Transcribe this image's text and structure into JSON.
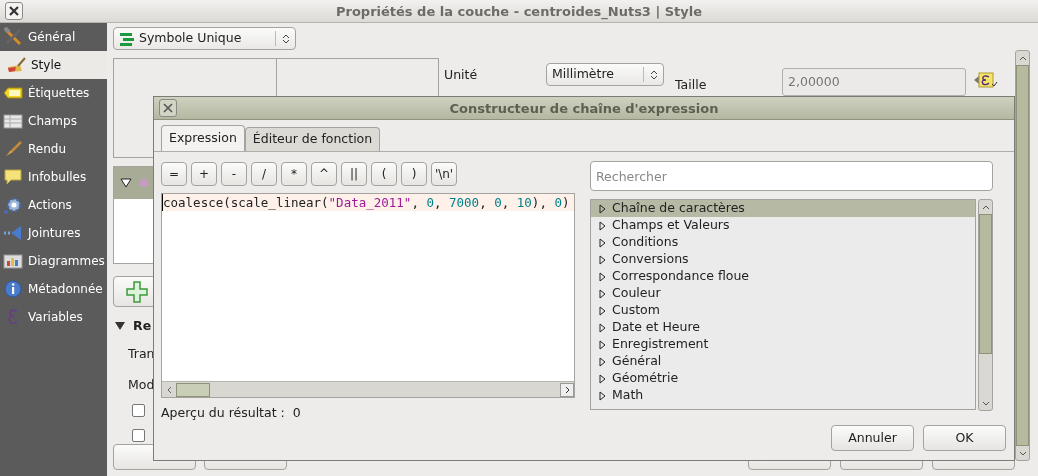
{
  "window": {
    "title": "Propriétés de la couche - centroides_Nuts3 | Style"
  },
  "sidebar": {
    "items": [
      {
        "label": "Général",
        "selected": false
      },
      {
        "label": "Style",
        "selected": true
      },
      {
        "label": "Étiquettes",
        "selected": false
      },
      {
        "label": "Champs",
        "selected": false
      },
      {
        "label": "Rendu",
        "selected": false
      },
      {
        "label": "Infobulles",
        "selected": false
      },
      {
        "label": "Actions",
        "selected": false
      },
      {
        "label": "Jointures",
        "selected": false
      },
      {
        "label": "Diagrammes",
        "selected": false
      },
      {
        "label": "Métadonnée",
        "selected": false
      },
      {
        "label": "Variables",
        "selected": false
      }
    ]
  },
  "style_panel": {
    "renderer": "Symbole Unique",
    "unit_label": "Unité",
    "unit": "Millimètre",
    "size_label": "Taille",
    "size": "2,00000",
    "section_title": "Re",
    "rows": [
      "Tran",
      "Mod"
    ],
    "checkboxes": [
      {
        "checked": false
      },
      {
        "checked": false
      }
    ]
  },
  "dialog": {
    "title": "Constructeur de chaîne d'expression",
    "tabs": [
      {
        "label": "Expression",
        "selected": true
      },
      {
        "label": "Éditeur de fonction",
        "selected": false
      }
    ],
    "operators": [
      "=",
      "+",
      "-",
      "/",
      "*",
      "^",
      "||",
      "(",
      ")",
      "'\\n'"
    ],
    "expression": [
      {
        "kind": "text",
        "text": "coalesce(scale_linear("
      },
      {
        "kind": "string",
        "text": "\"Data_2011\""
      },
      {
        "kind": "text",
        "text": ", "
      },
      {
        "kind": "number",
        "text": "0"
      },
      {
        "kind": "text",
        "text": ", "
      },
      {
        "kind": "number",
        "text": "7000"
      },
      {
        "kind": "text",
        "text": ", "
      },
      {
        "kind": "number",
        "text": "0"
      },
      {
        "kind": "text",
        "text": ", "
      },
      {
        "kind": "number",
        "text": "10"
      },
      {
        "kind": "text",
        "text": "), "
      },
      {
        "kind": "number",
        "text": "0"
      },
      {
        "kind": "text",
        "text": ")"
      }
    ],
    "preview_label": "Aperçu du résultat :",
    "preview_value": "0",
    "search": {
      "placeholder": "Rechercher"
    },
    "categories": [
      {
        "label": "Chaîne de caractères",
        "selected": true
      },
      {
        "label": "Champs et Valeurs",
        "selected": false
      },
      {
        "label": "Conditions",
        "selected": false
      },
      {
        "label": "Conversions",
        "selected": false
      },
      {
        "label": "Correspondance floue",
        "selected": false
      },
      {
        "label": "Couleur",
        "selected": false
      },
      {
        "label": "Custom",
        "selected": false
      },
      {
        "label": "Date et Heure",
        "selected": false
      },
      {
        "label": "Enregistrement",
        "selected": false
      },
      {
        "label": "Général",
        "selected": false
      },
      {
        "label": "Géométrie",
        "selected": false
      },
      {
        "label": "Math",
        "selected": false
      }
    ],
    "buttons": [
      "Annuler",
      "OK"
    ]
  }
}
